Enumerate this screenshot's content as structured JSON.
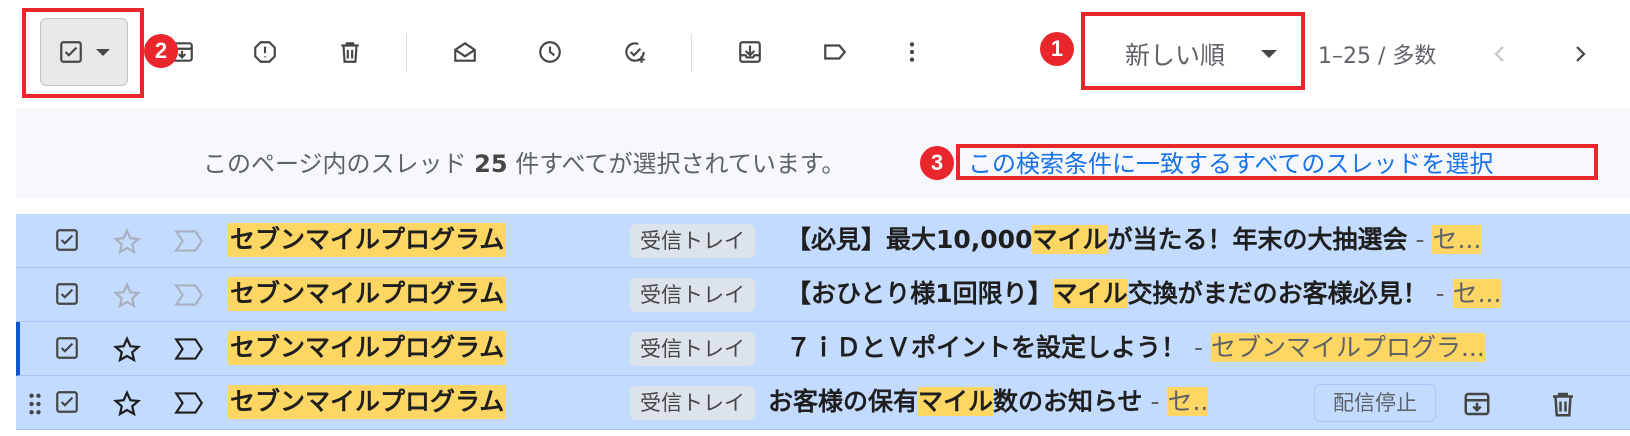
{
  "toolbar": {
    "sort_label": "新しい順",
    "page_range": "1–25 / 多数"
  },
  "annotations": [
    "1",
    "2",
    "3"
  ],
  "banner": {
    "prefix": "このページ内のスレッド ",
    "count": "25",
    "suffix": " 件すべてが選択されています。",
    "link": "この検索条件に一致するすべてのスレッドを選択"
  },
  "rows": [
    {
      "sender": "セブンマイルプログラム",
      "label": "受信トレイ",
      "subject_a": "【必見】最大10,000",
      "subject_hl": "マイル",
      "subject_b": "が当たる！年末の大抽選会",
      "sep": " - ",
      "snippet": "セ..."
    },
    {
      "sender": "セブンマイルプログラム",
      "label": "受信トレイ",
      "subject_a": "【おひとり様1回限り】",
      "subject_hl": "マイル",
      "subject_b": "交換がまだのお客様必見！",
      "sep": " - ",
      "snippet": "セ..."
    },
    {
      "sender": "セブンマイルプログラム",
      "label": "受信トレイ",
      "subject_a": "７ｉＤとＶポイントを設定しよう！",
      "subject_hl": "",
      "subject_b": "",
      "sep": " - ",
      "snippet": "セブンマイルプログラ..."
    },
    {
      "sender": "セブンマイルプログラム",
      "label": "受信トレイ",
      "subject_a": "お客様の保有",
      "subject_hl": "マイル",
      "subject_b": "数のお知らせ",
      "sep": " - ",
      "snippet": "セ..",
      "unsubscribe": "配信停止"
    }
  ],
  "colors": {
    "annotation": "#e8262b",
    "selected_row": "#c2dbff",
    "highlight": "#fdd663",
    "link": "#1a73e8"
  }
}
